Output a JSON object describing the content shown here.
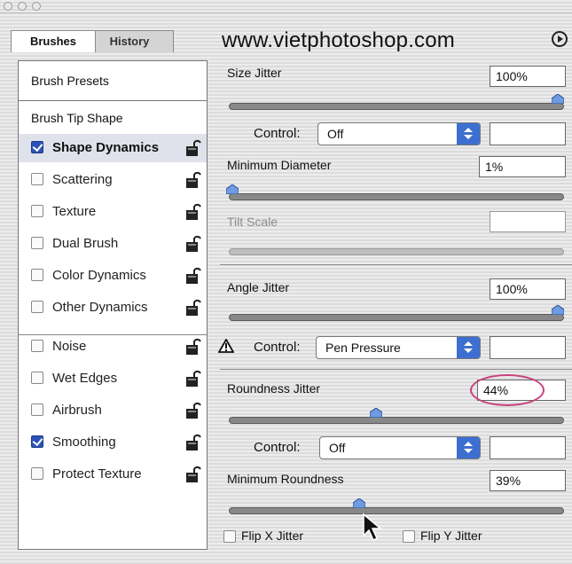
{
  "window": {
    "title": ""
  },
  "tabs": [
    {
      "label": "Brushes",
      "active": true
    },
    {
      "label": "History",
      "active": false
    }
  ],
  "watermark": "www.vietphotoshop.com",
  "left_panel": {
    "presets_label": "Brush Presets",
    "tip_shape_label": "Brush Tip Shape",
    "items": [
      {
        "label": "Shape Dynamics",
        "checked": true,
        "selected": true
      },
      {
        "label": "Scattering",
        "checked": false
      },
      {
        "label": "Texture",
        "checked": false
      },
      {
        "label": "Dual Brush",
        "checked": false
      },
      {
        "label": "Color Dynamics",
        "checked": false
      },
      {
        "label": "Other Dynamics",
        "checked": false
      },
      {
        "label": "Noise",
        "checked": false
      },
      {
        "label": "Wet Edges",
        "checked": false
      },
      {
        "label": "Airbrush",
        "checked": false
      },
      {
        "label": "Smoothing",
        "checked": true
      },
      {
        "label": "Protect Texture",
        "checked": false
      }
    ]
  },
  "settings": {
    "size_jitter": {
      "label": "Size Jitter",
      "value": "100%",
      "slider": 1.0
    },
    "size_control": {
      "label": "Control:",
      "value": "Off",
      "field": ""
    },
    "minimum_diameter": {
      "label": "Minimum Diameter",
      "value": "1%",
      "slider": 0.01
    },
    "tilt_scale": {
      "label": "Tilt Scale",
      "value": "",
      "disabled": true
    },
    "angle_jitter": {
      "label": "Angle Jitter",
      "value": "100%",
      "slider": 1.0
    },
    "angle_control": {
      "label": "Control:",
      "value": "Pen Pressure",
      "field": "",
      "warning": true
    },
    "roundness_jitter": {
      "label": "Roundness Jitter",
      "value": "44%",
      "slider": 0.44
    },
    "roundness_control": {
      "label": "Control:",
      "value": "Off",
      "field": ""
    },
    "minimum_roundness": {
      "label": "Minimum Roundness",
      "value": "39%",
      "slider": 0.39
    },
    "flip_x": {
      "label": "Flip X Jitter",
      "checked": false
    },
    "flip_y": {
      "label": "Flip Y Jitter",
      "checked": false
    }
  },
  "colors": {
    "accent_blue": "#3d6fd1",
    "highlight_circle": "#c8417b"
  },
  "icons": [
    "lock-icon",
    "warning-icon",
    "cursor-arrow-icon",
    "flyout-menu-icon"
  ]
}
